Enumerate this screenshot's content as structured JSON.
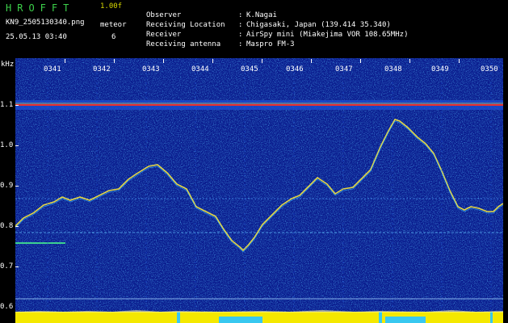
{
  "header": {
    "app_title": "HROFFT",
    "version": "1.00f",
    "filename": "KN9_2505130340.png",
    "datetime": "25.05.13 03:40",
    "meteor_label": "meteor",
    "meteor_count": "6"
  },
  "info": [
    {
      "key": "Observer",
      "value": "K.Nagai"
    },
    {
      "key": "Receiving Location",
      "value": "Chigasaki, Japan (139.414 35.340)"
    },
    {
      "key": "Receiver",
      "value": "AirSpy mini (Miakejima VOR 108.65MHz)"
    },
    {
      "key": "Receiving antenna",
      "value": "Maspro FM-3"
    }
  ],
  "plot": {
    "unit_label": "kHz",
    "y_labels": [
      "1.1",
      "1.0",
      "0.9",
      "0.8",
      "0.7",
      "0.6"
    ],
    "time_labels": [
      "0341",
      "0342",
      "0343",
      "0344",
      "0345",
      "0346",
      "0347",
      "0348",
      "0349",
      "0350"
    ],
    "colors": {
      "background": "#0a1c8e",
      "trace": "#f0e040",
      "carrier": "#e83030",
      "bar": "#f4e800",
      "bar_gap": "#38c8f0"
    }
  }
}
